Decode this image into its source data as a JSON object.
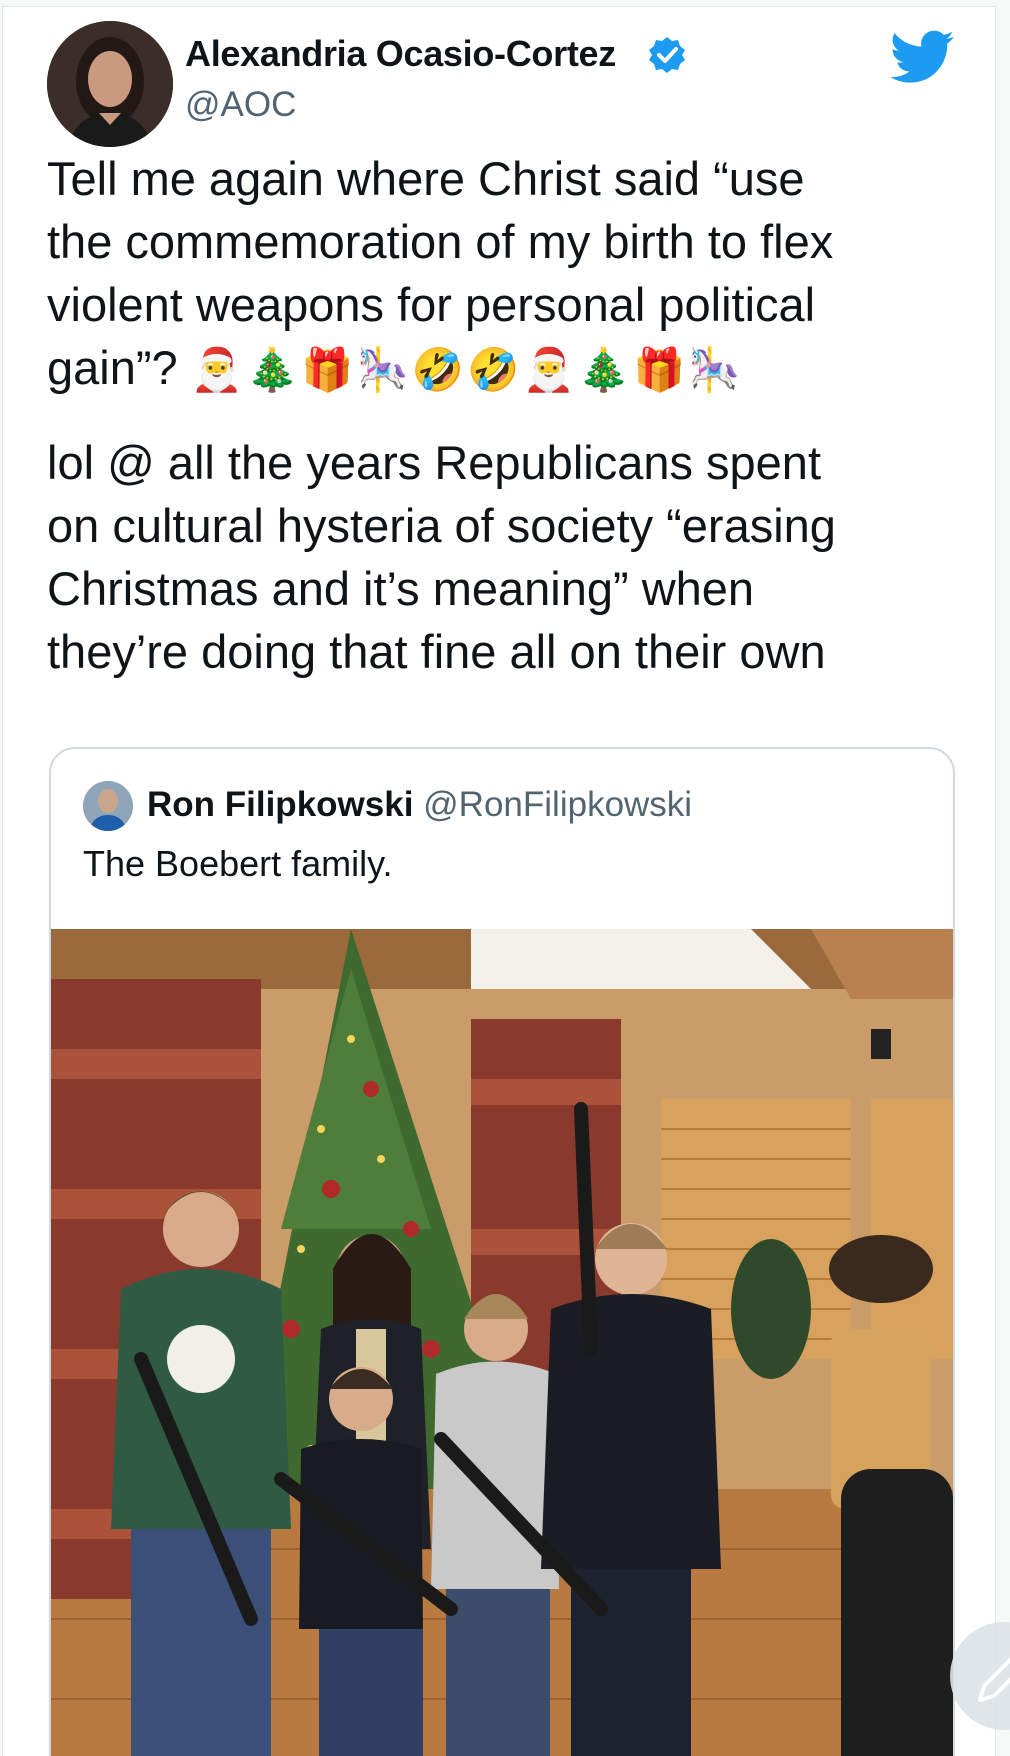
{
  "author": {
    "name": "Alexandria Ocasio-Cortez",
    "handle": "@AOC",
    "verified": true
  },
  "tweet": {
    "line1": "Tell me again where Christ said “use",
    "line2": "the commemoration of my birth to flex",
    "line3": "violent weapons for personal political",
    "line4": "gain”?",
    "emojis": "🎅🎄🎁🎠🤣🤣🎅🎄🎁🎠",
    "line5": "lol @ all the years Republicans spent",
    "line6": "on cultural hysteria of society “erasing",
    "line7": "Christmas and it’s meaning” when",
    "line8": "they’re doing that fine all on their own"
  },
  "quoted_tweet": {
    "name": "Ron Filipkowski",
    "handle": "@RonFilipkowski",
    "text": "The Boebert family."
  },
  "icons": {
    "verified": "verified-badge-icon",
    "brand": "twitter-bird-icon",
    "compose": "compose-pencil-icon"
  },
  "colors": {
    "twitter_blue": "#1d9bf0",
    "text": "#0f1419",
    "secondary": "#536471"
  }
}
